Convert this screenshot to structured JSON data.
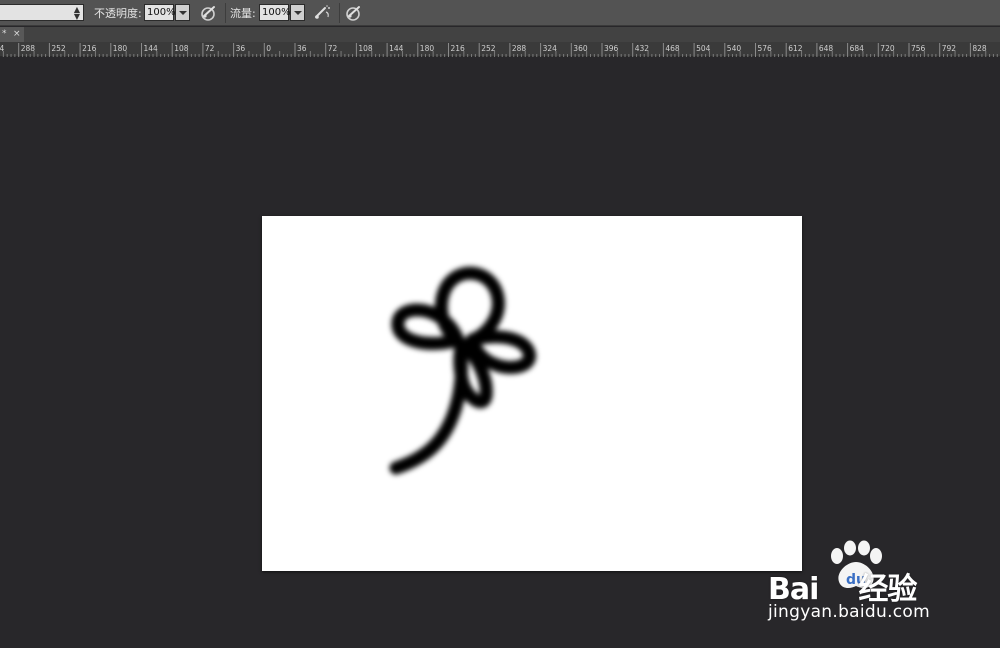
{
  "options_bar": {
    "opacity_label": "不透明度:",
    "opacity_value": "100%",
    "flow_label": "流量:",
    "flow_value": "100%",
    "icons": [
      "pressure-opacity-icon",
      "airbrush-icon",
      "pressure-size-icon"
    ]
  },
  "document_tab": {
    "modified_mark": "*",
    "close_glyph": "×"
  },
  "ruler": {
    "labels": [
      "324",
      "288",
      "252",
      "216",
      "180",
      "144",
      "108",
      "72",
      "36",
      "0",
      "36",
      "72",
      "108",
      "144",
      "180",
      "216",
      "252",
      "288",
      "324",
      "360",
      "396",
      "432",
      "468",
      "504",
      "540",
      "576",
      "612",
      "648",
      "684",
      "720",
      "756",
      "792",
      "828",
      "864"
    ]
  },
  "watermark": {
    "logo_text_1": "Bai",
    "logo_text_2": "经验",
    "url": "jingyan.baidu.com"
  },
  "colors": {
    "workspace": "#28272a",
    "options_bar": "#535353",
    "canvas": "#ffffff",
    "brush_stroke": "#000000"
  }
}
